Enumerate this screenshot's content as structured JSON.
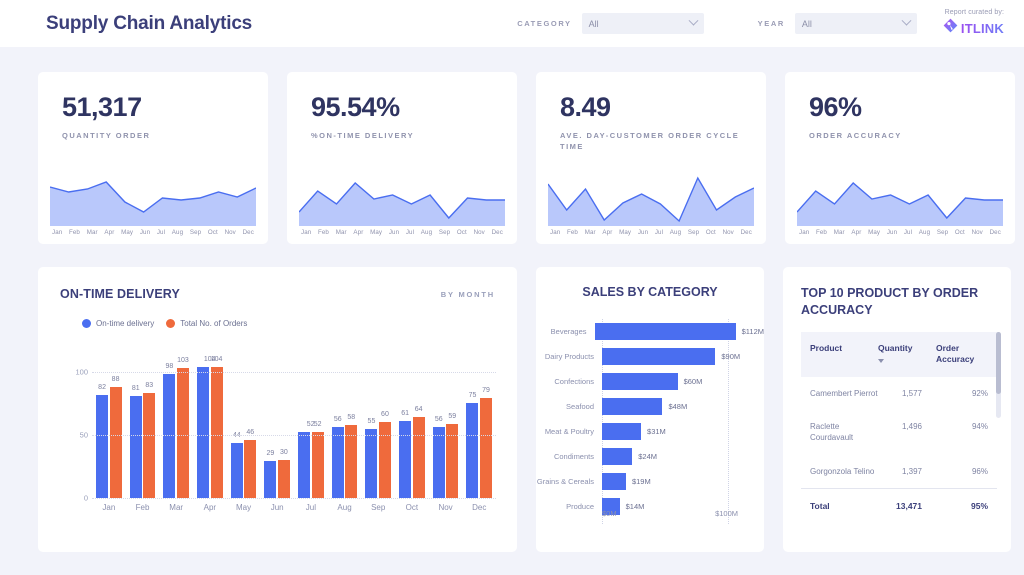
{
  "header": {
    "title": "Supply Chain Analytics",
    "filters": [
      {
        "label": "CATEGORY",
        "value": "All",
        "icon": "chevron-down-icon"
      },
      {
        "label": "YEAR",
        "value": "All",
        "icon": "chevron-down-icon"
      }
    ],
    "brand": {
      "caption": "Report curated by:",
      "name": "ITLINK",
      "logo_icon": "itlink-logo-icon"
    }
  },
  "kpis": [
    {
      "value": "51,317",
      "label": "QUANTITY ORDER",
      "months": [
        "Jan",
        "Feb",
        "Mar",
        "Apr",
        "May",
        "Jun",
        "Jul",
        "Aug",
        "Sep",
        "Oct",
        "Nov",
        "Dec"
      ],
      "spark": [
        72,
        62,
        68,
        82,
        42,
        22,
        50,
        46,
        50,
        62,
        52,
        70
      ]
    },
    {
      "value": "95.54%",
      "label": "%ON-TIME DELIVERY",
      "months": [
        "Jan",
        "Feb",
        "Mar",
        "Apr",
        "May",
        "Jun",
        "Jul",
        "Aug",
        "Sep",
        "Oct",
        "Nov",
        "Dec"
      ],
      "spark": [
        22,
        64,
        38,
        80,
        48,
        56,
        38,
        56,
        10,
        50,
        46,
        46
      ]
    },
    {
      "value": "8.49",
      "label": "AVE. DAY-CUSTOMER ORDER CYCLE TIME",
      "months": [
        "Jan",
        "Feb",
        "Mar",
        "Apr",
        "May",
        "Jun",
        "Jul",
        "Aug",
        "Sep",
        "Oct",
        "Nov",
        "Dec"
      ],
      "spark": [
        78,
        26,
        68,
        6,
        40,
        58,
        38,
        4,
        90,
        26,
        52,
        70
      ]
    },
    {
      "value": "96%",
      "label": "ORDER ACCURACY",
      "months": [
        "Jan",
        "Feb",
        "Mar",
        "Apr",
        "May",
        "Jun",
        "Jul",
        "Aug",
        "Sep",
        "Oct",
        "Nov",
        "Dec"
      ],
      "spark": [
        22,
        64,
        38,
        80,
        48,
        56,
        38,
        56,
        10,
        50,
        46,
        46
      ]
    }
  ],
  "on_time_delivery": {
    "title": "ON-TIME DELIVERY",
    "subtitle": "BY MONTH",
    "legend": [
      {
        "label": "On-time delivery",
        "color": "#4a6ef0"
      },
      {
        "label": "Total No. of Orders",
        "color": "#ef6a3c"
      }
    ]
  },
  "sales_by_category": {
    "title": "SALES BY CATEGORY"
  },
  "top10": {
    "title": "TOP 10 PRODUCT BY ORDER ACCURACY",
    "columns": [
      "Product",
      "Quantity",
      "Order Accuracy"
    ],
    "sort_icon": "sort-descending-caret-icon",
    "rows": [
      {
        "product": "Camembert Pierrot",
        "quantity": "1,577",
        "accuracy": "92%"
      },
      {
        "product": "Raclette Courdavault",
        "quantity": "1,496",
        "accuracy": "94%"
      },
      {
        "product": "Gorgonzola Telino",
        "quantity": "1,397",
        "accuracy": "96%"
      }
    ],
    "total": {
      "product": "Total",
      "quantity": "13,471",
      "accuracy": "95%"
    }
  },
  "chart_data": [
    {
      "type": "bar",
      "title": "ON-TIME DELIVERY",
      "subtitle": "BY MONTH",
      "categories": [
        "Jan",
        "Feb",
        "Mar",
        "Apr",
        "May",
        "Jun",
        "Jul",
        "Aug",
        "Sep",
        "Oct",
        "Nov",
        "Dec"
      ],
      "series": [
        {
          "name": "On-time delivery",
          "color": "#4a6ef0",
          "values": [
            82,
            81,
            98,
            104,
            44,
            29,
            52,
            56,
            55,
            61,
            56,
            75
          ]
        },
        {
          "name": "Total No. of Orders",
          "color": "#ef6a3c",
          "values": [
            88,
            83,
            103,
            104,
            46,
            30,
            52,
            58,
            60,
            64,
            59,
            79
          ]
        }
      ],
      "ylim": [
        0,
        115
      ],
      "yticks": [
        0,
        50,
        100
      ],
      "xlabel": "",
      "ylabel": "",
      "grid": true,
      "legend_position": "top-left"
    },
    {
      "type": "bar",
      "orientation": "horizontal",
      "title": "SALES BY CATEGORY",
      "categories": [
        "Beverages",
        "Dairy Products",
        "Confections",
        "Seafood",
        "Meat & Poultry",
        "Condiments",
        "Grains & Cereals",
        "Produce"
      ],
      "values": [
        112,
        90,
        60,
        48,
        31,
        24,
        19,
        14
      ],
      "value_labels": [
        "$112M",
        "$90M",
        "$60M",
        "$48M",
        "$31M",
        "$24M",
        "$19M",
        "$14M"
      ],
      "xlim": [
        0,
        100
      ],
      "xticks": [
        0,
        100
      ],
      "xtick_labels": [
        "$0M",
        "$100M"
      ],
      "color": "#4a6ef0",
      "grid": true
    },
    {
      "type": "table",
      "title": "TOP 10 PRODUCT BY ORDER ACCURACY",
      "columns": [
        "Product",
        "Quantity",
        "Order Accuracy"
      ],
      "rows": [
        [
          "Camembert Pierrot",
          "1,577",
          "92%"
        ],
        [
          "Raclette Courdavault",
          "1,496",
          "94%"
        ],
        [
          "Gorgonzola Telino",
          "1,397",
          "96%"
        ]
      ],
      "total_row": [
        "Total",
        "13,471",
        "95%"
      ]
    }
  ],
  "colors": {
    "page_bg": "#f2f3fa",
    "card_bg": "#ffffff",
    "title": "#3b3f7a",
    "muted": "#9093ad",
    "blue": "#4a6ef0",
    "orange": "#ef6a3c",
    "spark_fill": "#b9c8fb"
  }
}
